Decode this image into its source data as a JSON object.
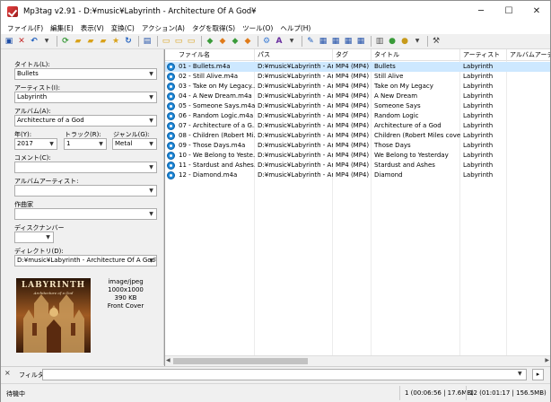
{
  "window": {
    "title": "Mp3tag v2.91  -  D:¥music¥Labyrinth - Architecture Of A God¥",
    "minimize": "─",
    "maximize": "☐",
    "close": "✕"
  },
  "menu": [
    "ファイル(F)",
    "編集(E)",
    "表示(V)",
    "変換(C)",
    "アクション(A)",
    "タグを取得(S)",
    "ツール(O)",
    "ヘルプ(H)"
  ],
  "fields": {
    "title_label": "タイトル(L):",
    "title_value": "Bullets",
    "artist_label": "アーティスト(I):",
    "artist_value": "Labyrinth",
    "album_label": "アルバム(A):",
    "album_value": "Architecture of a God",
    "year_label": "年(Y):",
    "year_value": "2017",
    "track_label": "トラック(R):",
    "track_value": "1",
    "genre_label": "ジャンル(G):",
    "genre_value": "Metal",
    "comment_label": "コメント(C):",
    "comment_value": "",
    "album_artist_label": "アルバムアーティスト:",
    "album_artist_value": "",
    "composer_label": "作曲家",
    "composer_value": "",
    "disc_label": "ディスクナンバー",
    "disc_value": "",
    "dir_label": "ディレクトリ(D):",
    "dir_value": "D:¥music¥Labyrinth - Architecture Of A God¥"
  },
  "cover": {
    "band": "LABYRINTH",
    "album": "Architecture of a God",
    "mime": "image/jpeg",
    "dims": "1000x1000",
    "size": "390 KB",
    "type": "Front Cover"
  },
  "columns": [
    "ファイル名",
    "パス",
    "タグ",
    "タイトル",
    "アーティスト",
    "アルバムアーティ"
  ],
  "rows": [
    [
      "01 - Bullets.m4a",
      "D:¥music¥Labyrinth - Ar...",
      "MP4 (MP4)",
      "Bullets",
      "Labyrinth"
    ],
    [
      "02 - Still Alive.m4a",
      "D:¥music¥Labyrinth - Ar...",
      "MP4 (MP4)",
      "Still Alive",
      "Labyrinth"
    ],
    [
      "03 - Take on My Legacy...",
      "D:¥music¥Labyrinth - Ar...",
      "MP4 (MP4)",
      "Take on My Legacy",
      "Labyrinth"
    ],
    [
      "04 - A New Dream.m4a",
      "D:¥music¥Labyrinth - Ar...",
      "MP4 (MP4)",
      "A New Dream",
      "Labyrinth"
    ],
    [
      "05 - Someone Says.m4a",
      "D:¥music¥Labyrinth - Ar...",
      "MP4 (MP4)",
      "Someone Says",
      "Labyrinth"
    ],
    [
      "06 - Random Logic.m4a",
      "D:¥music¥Labyrinth - Ar...",
      "MP4 (MP4)",
      "Random Logic",
      "Labyrinth"
    ],
    [
      "07 - Architecture of a G...",
      "D:¥music¥Labyrinth - Ar...",
      "MP4 (MP4)",
      "Architecture of a God",
      "Labyrinth"
    ],
    [
      "08 - Children (Robert Mi...",
      "D:¥music¥Labyrinth - Ar...",
      "MP4 (MP4)",
      "Children (Robert Miles cover)",
      "Labyrinth"
    ],
    [
      "09 - Those Days.m4a",
      "D:¥music¥Labyrinth - Ar...",
      "MP4 (MP4)",
      "Those Days",
      "Labyrinth"
    ],
    [
      "10 - We Belong to Yeste...",
      "D:¥music¥Labyrinth - Ar...",
      "MP4 (MP4)",
      "We Belong to Yesterday",
      "Labyrinth"
    ],
    [
      "11 - Stardust and Ashes....",
      "D:¥music¥Labyrinth - Ar...",
      "MP4 (MP4)",
      "Stardust and Ashes",
      "Labyrinth"
    ],
    [
      "12 - Diamond.m4a",
      "D:¥music¥Labyrinth - Ar...",
      "MP4 (MP4)",
      "Diamond",
      "Labyrinth"
    ]
  ],
  "filter": {
    "label": "フィルタ:",
    "value": ""
  },
  "status": {
    "left": "待機中",
    "selection": "1 (00:06:56 | 17.6MB)",
    "total": "12 (01:01:17 | 156.5MB)"
  }
}
